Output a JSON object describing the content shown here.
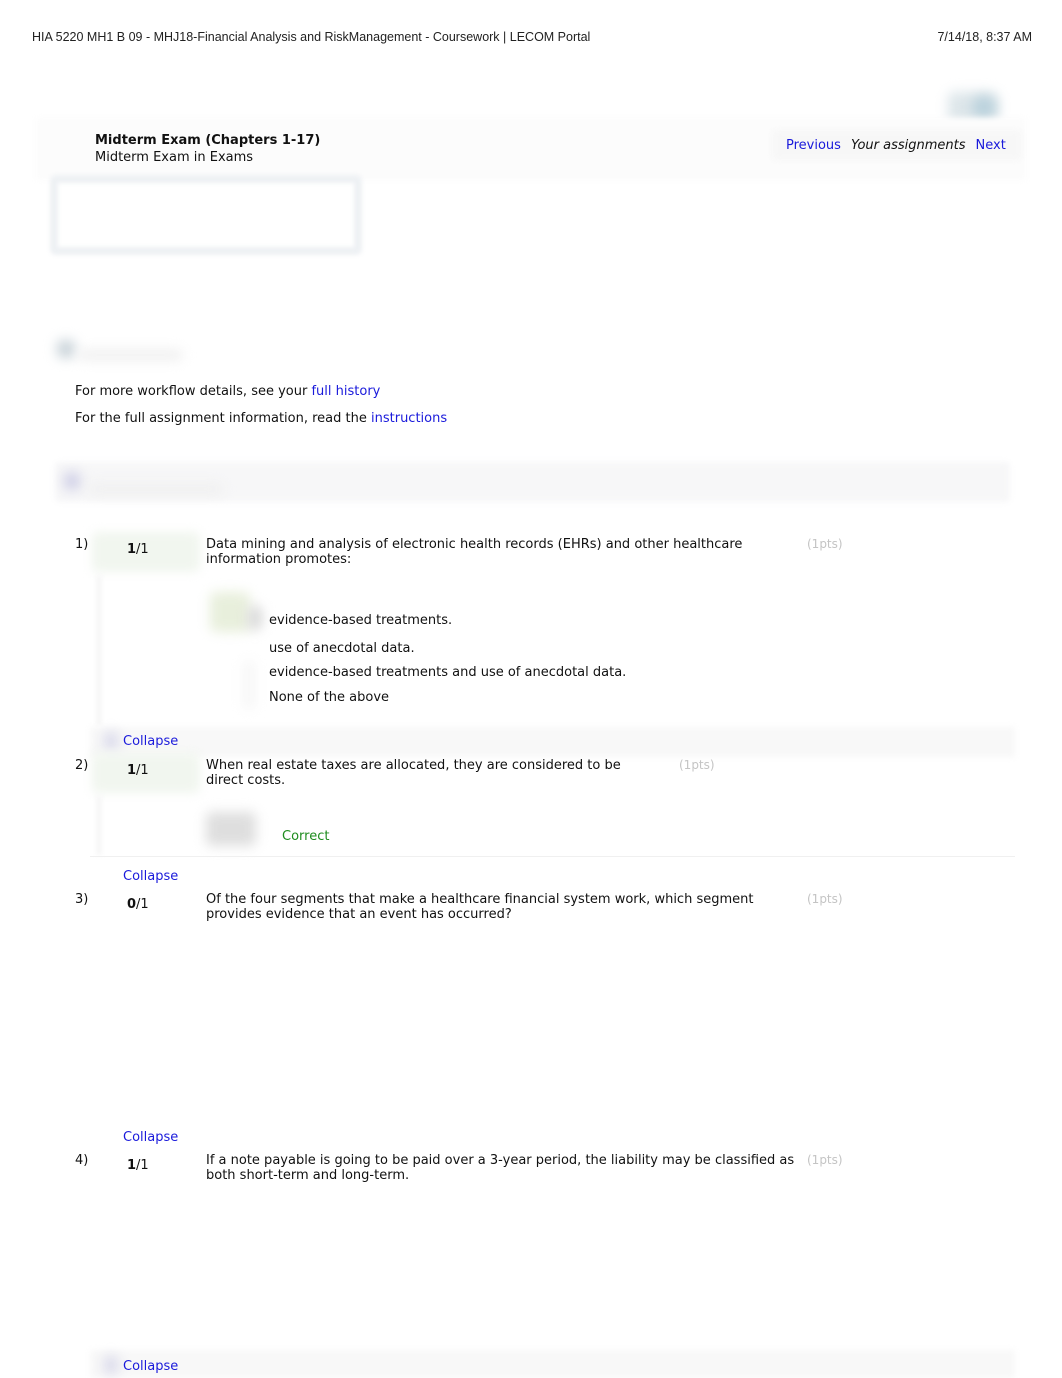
{
  "print_header": {
    "title": "HIA 5220 MH1 B 09 - MHJ18-Financial Analysis and RiskManagement - Coursework | LECOM Portal",
    "datetime": "7/14/18, 8:37 AM"
  },
  "assignment": {
    "title": "Midterm Exam (Chapters 1-17)",
    "subtitle": "Midterm Exam in Exams"
  },
  "nav": {
    "previous": "Previous",
    "your_assignments": "Your assignments",
    "next": "Next"
  },
  "info": {
    "history_prefix": "For more workflow details, see your ",
    "history_link": "full history",
    "instructions_prefix": "For the full assignment information, read the ",
    "instructions_link": "instructions"
  },
  "questions": [
    {
      "number": "1)",
      "score": "1",
      "max": "/1",
      "text": "Data mining and analysis of electronic health records (EHRs) and other healthcare information promotes:",
      "points": "(1pts)",
      "choices": [
        "evidence-based treatments.",
        "use of anecdotal data.",
        "evidence-based treatments and use of anecdotal data.",
        "None of the above"
      ],
      "collapse": "Collapse"
    },
    {
      "number": "2)",
      "score": "1",
      "max": "/1",
      "text": "When real estate taxes are allocated, they are considered to be direct costs.",
      "points": "(1pts)",
      "result": "Correct",
      "collapse": "Collapse"
    },
    {
      "number": "3)",
      "score": "0",
      "max": "/1",
      "text": "Of the four segments that make a healthcare financial system work, which segment provides evidence that an event has occurred?",
      "points": "(1pts)",
      "collapse": "Collapse"
    },
    {
      "number": "4)",
      "score": "1",
      "max": "/1",
      "text": "If a note payable is going to be paid over a 3-year period, the liability may be classified as both short-term and long-term.",
      "points": "(1pts)",
      "collapse": "Collapse"
    }
  ],
  "colors": {
    "link": "#1a1adb",
    "correct": "#1e8c1e",
    "points": "#c4c4c4"
  }
}
